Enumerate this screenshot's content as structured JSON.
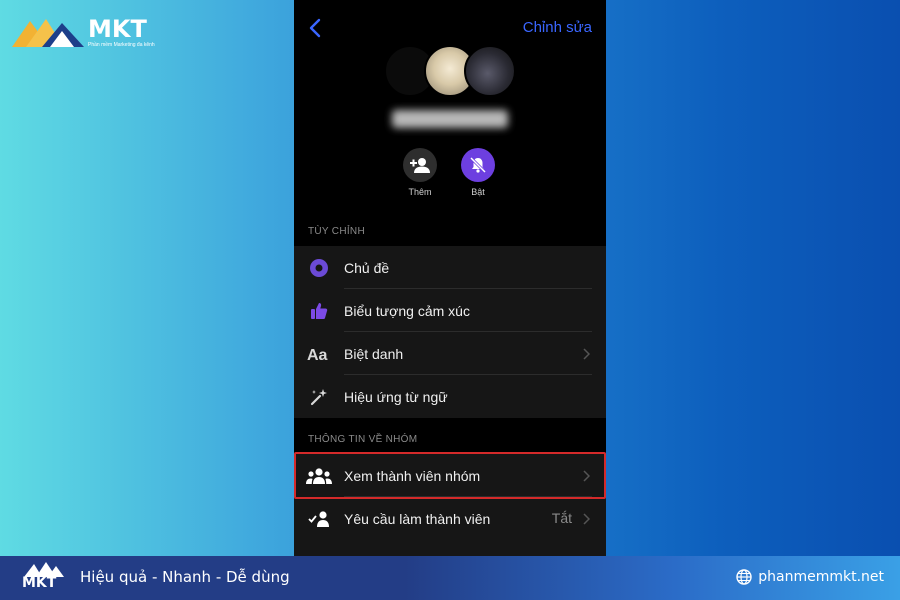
{
  "brand": {
    "logo_text": "MKT",
    "logo_tagline": "Phần mềm Marketing đa kênh",
    "slogan": "Hiệu quả - Nhanh  - Dễ dùng",
    "website": "phanmemmkt.net"
  },
  "header": {
    "back_icon": "chevron-left-icon",
    "edit_label": "Chỉnh sửa"
  },
  "actions": {
    "add_label": "Thêm",
    "add_icon": "add-person-icon",
    "mute_label": "Bật",
    "mute_icon": "bell-off-icon"
  },
  "sections": {
    "customize_label": "TÙY CHỈNH",
    "group_info_label": "THÔNG TIN VỀ NHÓM"
  },
  "customize_items": [
    {
      "label": "Chủ đề",
      "icon": "theme-circle-icon"
    },
    {
      "label": "Biểu tượng cảm xúc",
      "icon": "thumbs-up-icon"
    },
    {
      "label": "Biệt danh",
      "icon": "text-aa-icon"
    },
    {
      "label": "Hiệu ứng từ ngữ",
      "icon": "sparkle-wand-icon"
    }
  ],
  "group_items": [
    {
      "label": "Xem thành viên nhóm",
      "icon": "group-people-icon"
    },
    {
      "label": "Yêu cầu làm thành viên",
      "icon": "person-check-icon",
      "value": "Tắt"
    }
  ],
  "colors": {
    "accent": "#3a66ff",
    "mute_button": "#6d3fe0",
    "highlight_border": "#d42a2a",
    "theme_icon": "#6b4ad6"
  }
}
